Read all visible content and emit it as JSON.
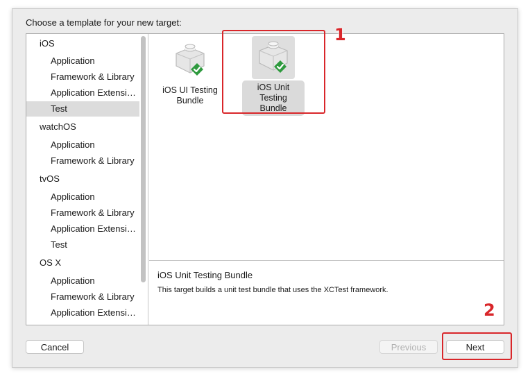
{
  "dialog": {
    "prompt": "Choose a template for your new target:"
  },
  "sidebar": {
    "rows": [
      {
        "kind": "group",
        "label": "iOS"
      },
      {
        "kind": "item",
        "label": "Application"
      },
      {
        "kind": "item",
        "label": "Framework & Library"
      },
      {
        "kind": "item",
        "label": "Application Extensi…"
      },
      {
        "kind": "item",
        "label": "Test",
        "selected": true
      },
      {
        "kind": "group",
        "label": "watchOS"
      },
      {
        "kind": "item",
        "label": "Application"
      },
      {
        "kind": "item",
        "label": "Framework & Library"
      },
      {
        "kind": "group",
        "label": "tvOS"
      },
      {
        "kind": "item",
        "label": "Application"
      },
      {
        "kind": "item",
        "label": "Framework & Library"
      },
      {
        "kind": "item",
        "label": "Application Extensi…"
      },
      {
        "kind": "item",
        "label": "Test"
      },
      {
        "kind": "group",
        "label": "OS X"
      },
      {
        "kind": "item",
        "label": "Application"
      },
      {
        "kind": "item",
        "label": "Framework & Library"
      },
      {
        "kind": "item",
        "label": "Application Extensi…"
      }
    ]
  },
  "templates": [
    {
      "line1": "iOS UI Testing",
      "line2": "Bundle",
      "icon": "test-bundle-icon",
      "selected": false
    },
    {
      "line1": "iOS Unit Testing",
      "line2": "Bundle",
      "icon": "test-bundle-icon",
      "selected": true
    }
  ],
  "description": {
    "title": "iOS Unit Testing Bundle",
    "text": "This target builds a unit test bundle that uses the XCTest framework."
  },
  "buttons": {
    "cancel": "Cancel",
    "previous": "Previous",
    "next": "Next"
  },
  "annotations": {
    "marker1": "1",
    "marker2": "2",
    "color": "#d9262a"
  },
  "colors": {
    "selection": "#dcdcdc",
    "checkmark": "#2e9a3e"
  }
}
